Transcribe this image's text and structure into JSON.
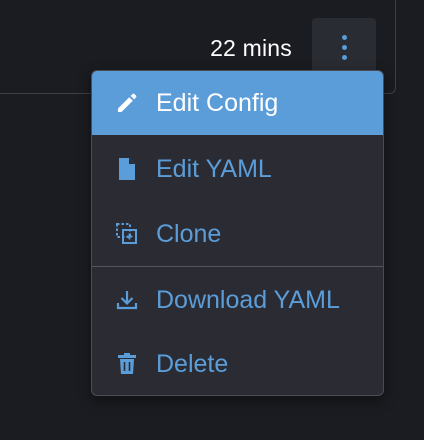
{
  "row": {
    "age": "22 mins"
  },
  "menu": {
    "items": [
      {
        "label": "Edit Config",
        "icon": "pencil-icon",
        "active": true
      },
      {
        "label": "Edit YAML",
        "icon": "file-icon",
        "active": false
      },
      {
        "label": "Clone",
        "icon": "clone-icon",
        "active": false
      },
      {
        "label": "Download YAML",
        "icon": "download-icon",
        "active": false
      },
      {
        "label": "Delete",
        "icon": "trash-icon",
        "active": false
      }
    ]
  },
  "colors": {
    "accent": "#5b9dd9",
    "background": "#1b1c21",
    "menu_background": "#2b2c33",
    "text_active": "#ffffff"
  }
}
